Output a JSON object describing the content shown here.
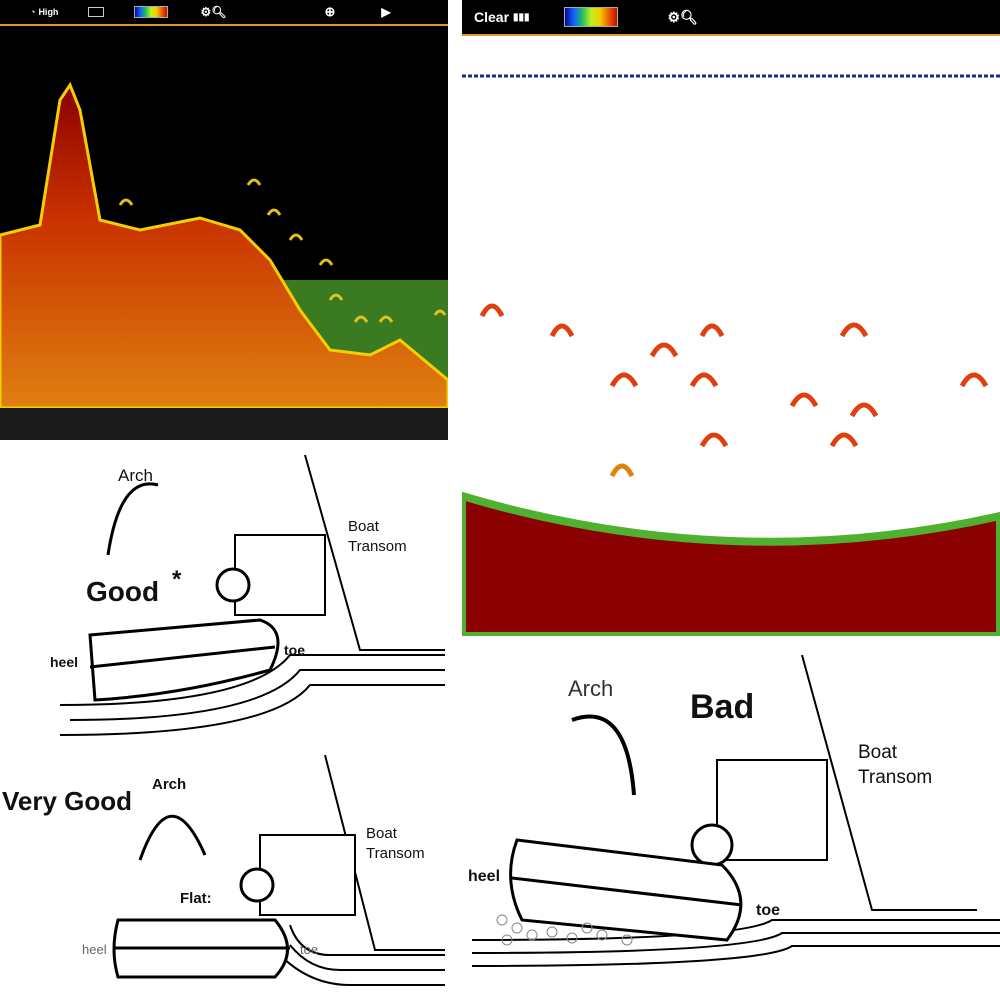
{
  "left_sonar": {
    "toolbar": {
      "sensitivity": "High",
      "icons": [
        "sensitivity-icon",
        "screen-icon",
        "color-scale",
        "settings-zoom-icon",
        "crosshair-icon",
        "play-icon"
      ]
    }
  },
  "right_sonar": {
    "toolbar": {
      "mode": "Clear",
      "icons": [
        "signal-icon",
        "color-scale",
        "settings-zoom-icon"
      ]
    }
  },
  "diagram_good": {
    "arch": "Arch",
    "rating": "Good",
    "asterisk": "*",
    "transom": [
      "Boat",
      "Transom"
    ],
    "heel": "heel",
    "toe": "toe"
  },
  "diagram_very_good": {
    "arch": "Arch",
    "rating": "Very Good",
    "flat": "Flat:",
    "transom": [
      "Boat",
      "Transom"
    ],
    "heel": "heel",
    "toe": "toe"
  },
  "diagram_bad": {
    "arch": "Arch",
    "rating": "Bad",
    "transom": [
      "Boat",
      "Transom"
    ],
    "heel": "heel",
    "toe": "toe"
  },
  "colors": {
    "toolbar_border": "#d99a2b",
    "bottom_red": "#8b0000"
  }
}
